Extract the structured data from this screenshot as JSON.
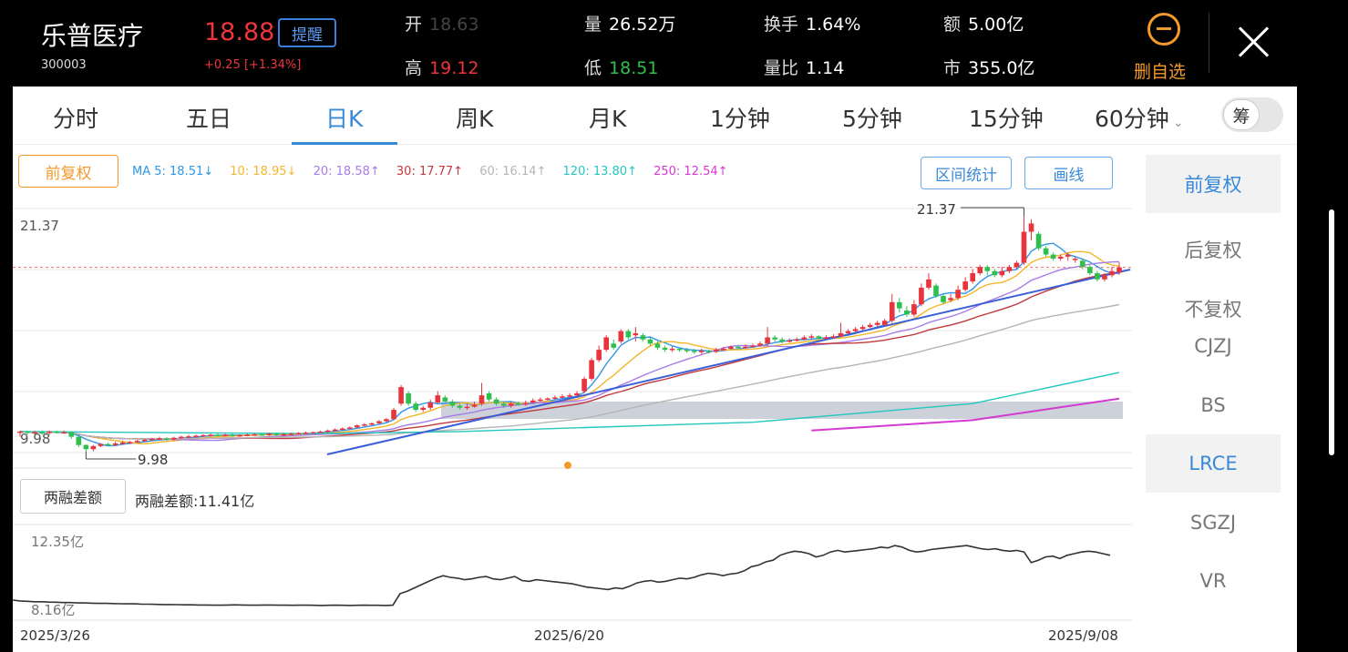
{
  "header": {
    "name": "乐普医疗",
    "code": "300003",
    "price": "18.88",
    "change": "+0.25 [+1.34%]",
    "alert_label": "提醒",
    "open_label": "开",
    "open_value": "18.63",
    "high_label": "高",
    "high_value": "19.12",
    "volume_label": "量",
    "volume_value": "26.52万",
    "low_label": "低",
    "low_value": "18.51",
    "turnover_label": "换手",
    "turnover_value": "1.64%",
    "volratio_label": "量比",
    "volratio_value": "1.14",
    "amount_label": "额",
    "amount_value": "5.00亿",
    "mktcap_label": "市",
    "mktcap_value": "355.0亿",
    "delete_label": "删自选"
  },
  "tabs": [
    "分时",
    "五日",
    "日K",
    "周K",
    "月K",
    "1分钟",
    "5分钟",
    "15分钟",
    "60分钟"
  ],
  "active_tab": "日K",
  "chip_toggle": "筹",
  "toolbar": {
    "adjust_label": "前复权",
    "ma": [
      {
        "text": "MA 5: 18.51↓",
        "color": "#2f97e6"
      },
      {
        "text": "10: 18.95↓",
        "color": "#f3b62a"
      },
      {
        "text": "20: 18.58↑",
        "color": "#a77be8"
      },
      {
        "text": "30: 17.77↑",
        "color": "#c0393b"
      },
      {
        "text": "60: 16.14↑",
        "color": "#b5b5b5"
      },
      {
        "text": "120: 13.80↑",
        "color": "#22c7c0"
      },
      {
        "text": "250: 12.54↑",
        "color": "#d43ad1"
      }
    ],
    "range_stats_label": "区间统计",
    "draw_label": "画线"
  },
  "price_axis": {
    "top": "21.37",
    "bottom": "9.98"
  },
  "markers": {
    "high": "21.37",
    "low": "9.98"
  },
  "margin": {
    "button_label": "两融差额",
    "value_text": "两融差额:11.41亿",
    "axis_top": "12.35亿",
    "axis_bottom": "8.16亿"
  },
  "dates": [
    "2025/3/26",
    "2025/6/20",
    "2025/9/08"
  ],
  "side_menu": [
    "前复权",
    "后复权",
    "不复权",
    "CJZJ",
    "BS",
    "LRCE",
    "SGZJ",
    "VR"
  ],
  "colors": {
    "up": "#e8343c",
    "down": "#2fbf4f",
    "accent": "#3a89d9",
    "orange": "#f39a2b"
  },
  "chart_data": {
    "type": "candlestick",
    "price_range": [
      9.98,
      21.37
    ],
    "candles": [
      [
        10.9,
        10.95,
        10.7,
        11.0
      ],
      [
        10.95,
        10.9,
        10.8,
        11.0
      ],
      [
        10.9,
        10.92,
        10.8,
        11.0
      ],
      [
        10.92,
        10.88,
        10.8,
        11.0
      ],
      [
        10.88,
        10.95,
        10.8,
        11.0
      ],
      [
        10.95,
        10.9,
        10.85,
        11.0
      ],
      [
        10.9,
        10.92,
        10.85,
        11.0
      ],
      [
        10.92,
        10.7,
        10.6,
        10.95
      ],
      [
        10.7,
        10.3,
        10.2,
        10.72
      ],
      [
        10.3,
        10.1,
        9.98,
        10.35
      ],
      [
        10.1,
        10.25,
        10.0,
        10.3
      ],
      [
        10.25,
        10.35,
        10.2,
        10.4
      ],
      [
        10.35,
        10.3,
        10.25,
        10.4
      ],
      [
        10.3,
        10.38,
        10.25,
        10.45
      ],
      [
        10.38,
        10.42,
        10.3,
        10.5
      ],
      [
        10.42,
        10.45,
        10.35,
        10.5
      ],
      [
        10.45,
        10.5,
        10.4,
        10.55
      ],
      [
        10.5,
        10.55,
        10.45,
        10.6
      ],
      [
        10.55,
        10.6,
        10.5,
        10.65
      ],
      [
        10.6,
        10.62,
        10.55,
        10.7
      ],
      [
        10.62,
        10.58,
        10.5,
        10.68
      ],
      [
        10.58,
        10.65,
        10.5,
        10.7
      ],
      [
        10.65,
        10.7,
        10.6,
        10.75
      ],
      [
        10.7,
        10.72,
        10.65,
        10.8
      ],
      [
        10.72,
        10.75,
        10.65,
        10.8
      ],
      [
        10.75,
        10.78,
        10.7,
        10.82
      ],
      [
        10.78,
        10.8,
        10.72,
        10.85
      ],
      [
        10.8,
        10.78,
        10.72,
        10.85
      ],
      [
        10.78,
        10.8,
        10.72,
        10.85
      ],
      [
        10.8,
        10.75,
        10.7,
        10.85
      ],
      [
        10.75,
        10.78,
        10.7,
        10.82
      ],
      [
        10.78,
        10.8,
        10.72,
        10.85
      ],
      [
        10.8,
        10.82,
        10.75,
        10.88
      ],
      [
        10.82,
        10.8,
        10.75,
        10.88
      ],
      [
        10.8,
        10.85,
        10.75,
        10.9
      ],
      [
        10.85,
        10.8,
        10.75,
        10.9
      ],
      [
        10.8,
        10.82,
        10.75,
        10.88
      ],
      [
        10.82,
        10.85,
        10.78,
        10.9
      ],
      [
        10.85,
        10.88,
        10.8,
        10.92
      ],
      [
        10.88,
        10.9,
        10.82,
        10.95
      ],
      [
        10.9,
        10.92,
        10.85,
        10.95
      ],
      [
        10.92,
        10.95,
        10.88,
        11.0
      ],
      [
        10.95,
        11.0,
        10.9,
        11.05
      ],
      [
        11.0,
        11.05,
        10.95,
        11.1
      ],
      [
        11.05,
        11.1,
        11.0,
        11.15
      ],
      [
        11.1,
        11.15,
        11.05,
        11.2
      ],
      [
        11.15,
        11.25,
        11.1,
        11.3
      ],
      [
        11.25,
        11.3,
        11.2,
        11.35
      ],
      [
        11.3,
        11.35,
        11.25,
        11.4
      ],
      [
        11.35,
        11.45,
        11.3,
        11.5
      ],
      [
        11.45,
        11.55,
        11.4,
        11.6
      ],
      [
        11.55,
        12.0,
        11.5,
        12.1
      ],
      [
        12.3,
        13.1,
        12.2,
        13.2
      ],
      [
        12.8,
        12.3,
        12.2,
        12.9
      ],
      [
        12.3,
        12.0,
        11.9,
        12.4
      ],
      [
        12.0,
        12.1,
        11.9,
        12.2
      ],
      [
        12.1,
        12.35,
        12.0,
        12.5
      ],
      [
        12.35,
        12.7,
        12.3,
        12.9
      ],
      [
        12.6,
        12.4,
        12.3,
        12.7
      ],
      [
        12.4,
        12.2,
        12.1,
        12.5
      ],
      [
        12.2,
        12.1,
        12.0,
        12.3
      ],
      [
        12.1,
        12.15,
        12.0,
        12.3
      ],
      [
        12.15,
        12.25,
        12.1,
        12.4
      ],
      [
        12.3,
        12.7,
        12.2,
        13.3
      ],
      [
        12.8,
        12.5,
        12.4,
        12.9
      ],
      [
        12.5,
        12.3,
        12.2,
        12.6
      ],
      [
        12.3,
        12.2,
        12.1,
        12.4
      ],
      [
        12.2,
        12.3,
        12.1,
        12.4
      ],
      [
        12.3,
        12.28,
        12.2,
        12.4
      ],
      [
        12.28,
        12.32,
        12.2,
        12.45
      ],
      [
        12.35,
        12.45,
        12.3,
        12.55
      ],
      [
        12.45,
        12.5,
        12.4,
        12.6
      ],
      [
        12.5,
        12.55,
        12.45,
        12.6
      ],
      [
        12.55,
        12.6,
        12.5,
        12.7
      ],
      [
        12.6,
        12.65,
        12.55,
        12.75
      ],
      [
        12.65,
        12.7,
        12.6,
        12.8
      ],
      [
        12.7,
        12.8,
        12.65,
        12.9
      ],
      [
        12.9,
        13.5,
        12.8,
        13.6
      ],
      [
        13.5,
        14.4,
        13.4,
        14.5
      ],
      [
        14.4,
        14.9,
        14.3,
        15.1
      ],
      [
        14.9,
        15.5,
        14.8,
        15.6
      ],
      [
        15.2,
        15.0,
        14.9,
        15.4
      ],
      [
        15.3,
        15.8,
        15.2,
        15.9
      ],
      [
        15.8,
        15.5,
        15.4,
        15.9
      ],
      [
        15.6,
        15.7,
        15.3,
        16.0
      ],
      [
        15.6,
        15.4,
        15.3,
        15.7
      ],
      [
        15.4,
        15.2,
        15.1,
        15.5
      ],
      [
        15.2,
        15.0,
        14.9,
        15.3
      ],
      [
        15.0,
        14.9,
        14.8,
        15.1
      ],
      [
        14.9,
        14.95,
        14.8,
        15.05
      ],
      [
        14.95,
        14.9,
        14.8,
        15.0
      ],
      [
        14.9,
        14.85,
        14.75,
        15.0
      ],
      [
        14.85,
        14.8,
        14.7,
        14.95
      ],
      [
        14.8,
        14.85,
        14.7,
        14.95
      ],
      [
        14.85,
        14.8,
        14.72,
        14.9
      ],
      [
        14.8,
        14.9,
        14.75,
        15.0
      ],
      [
        14.9,
        14.95,
        14.85,
        15.05
      ],
      [
        14.95,
        15.05,
        14.9,
        15.1
      ],
      [
        15.05,
        15.0,
        14.95,
        15.1
      ],
      [
        15.0,
        15.05,
        14.95,
        15.15
      ],
      [
        15.05,
        15.1,
        15.0,
        15.2
      ],
      [
        15.1,
        15.2,
        15.05,
        15.3
      ],
      [
        15.2,
        15.5,
        15.1,
        16.0
      ],
      [
        15.5,
        15.4,
        15.3,
        15.6
      ],
      [
        15.4,
        15.3,
        15.2,
        15.5
      ],
      [
        15.3,
        15.35,
        15.25,
        15.45
      ],
      [
        15.35,
        15.4,
        15.3,
        15.5
      ],
      [
        15.4,
        15.5,
        15.35,
        15.6
      ],
      [
        15.5,
        15.55,
        15.45,
        15.65
      ],
      [
        15.55,
        15.45,
        15.4,
        15.6
      ],
      [
        15.45,
        15.5,
        15.4,
        15.6
      ],
      [
        15.5,
        15.55,
        15.45,
        15.65
      ],
      [
        15.55,
        15.7,
        15.5,
        16.2
      ],
      [
        15.7,
        15.8,
        15.65,
        15.9
      ],
      [
        15.8,
        15.9,
        15.75,
        16.0
      ],
      [
        15.9,
        16.0,
        15.85,
        16.1
      ],
      [
        16.0,
        16.1,
        15.95,
        16.2
      ],
      [
        16.1,
        16.2,
        16.0,
        16.3
      ],
      [
        16.1,
        16.3,
        16.05,
        16.4
      ],
      [
        16.3,
        17.2,
        16.2,
        17.6
      ],
      [
        17.2,
        16.9,
        16.7,
        17.4
      ],
      [
        16.8,
        16.6,
        16.5,
        17.0
      ],
      [
        16.6,
        17.1,
        16.5,
        17.3
      ],
      [
        17.1,
        17.9,
        17.0,
        18.1
      ],
      [
        17.9,
        18.3,
        17.8,
        18.6
      ],
      [
        18.0,
        17.5,
        17.4,
        18.1
      ],
      [
        17.5,
        17.2,
        17.1,
        17.6
      ],
      [
        17.3,
        17.4,
        17.2,
        17.6
      ],
      [
        17.4,
        17.8,
        17.3,
        18.0
      ],
      [
        17.8,
        18.2,
        17.7,
        18.4
      ],
      [
        18.2,
        18.6,
        18.1,
        18.8
      ],
      [
        18.6,
        18.9,
        18.5,
        19.0
      ],
      [
        18.9,
        18.7,
        18.5,
        19.0
      ],
      [
        18.7,
        18.5,
        18.4,
        18.8
      ],
      [
        18.5,
        18.7,
        18.4,
        18.9
      ],
      [
        18.7,
        18.9,
        18.6,
        19.0
      ],
      [
        18.9,
        19.1,
        18.8,
        19.2
      ],
      [
        19.1,
        20.6,
        19.0,
        21.37
      ],
      [
        20.6,
        21.0,
        20.2,
        21.2
      ],
      [
        20.5,
        19.8,
        19.7,
        20.6
      ],
      [
        19.8,
        19.5,
        19.4,
        19.9
      ],
      [
        19.5,
        19.3,
        19.2,
        19.6
      ],
      [
        19.3,
        19.4,
        19.2,
        19.5
      ],
      [
        19.4,
        19.5,
        19.2,
        19.6
      ],
      [
        19.3,
        19.3,
        19.1,
        19.4
      ],
      [
        19.2,
        18.9,
        18.8,
        19.3
      ],
      [
        18.9,
        18.6,
        18.5,
        19.0
      ],
      [
        18.6,
        18.3,
        18.2,
        18.7
      ],
      [
        18.3,
        18.5,
        18.2,
        18.6
      ],
      [
        18.5,
        18.7,
        18.4,
        18.9
      ],
      [
        18.63,
        18.88,
        18.51,
        19.12
      ]
    ],
    "ma_labels": [
      "MA5",
      "MA10",
      "MA20",
      "MA30",
      "MA60",
      "MA120",
      "MA250"
    ],
    "ma_last_values": [
      18.51,
      18.95,
      18.58,
      17.77,
      16.14,
      13.8,
      12.54
    ],
    "margin_series_range": [
      8.16,
      12.35
    ],
    "margin_last": 11.41,
    "margin_series": [
      8.55,
      8.5,
      8.48,
      8.45,
      8.45,
      8.43,
      8.42,
      8.4,
      8.4,
      8.38,
      8.38,
      8.36,
      8.35,
      8.35,
      8.34,
      8.33,
      8.32,
      8.32,
      8.3,
      8.3,
      8.29,
      8.28,
      8.28,
      8.27,
      8.26,
      8.26,
      8.25,
      8.25,
      8.24,
      8.24,
      8.25,
      8.26,
      8.25,
      8.24,
      8.24,
      8.25,
      8.25,
      8.24,
      8.24,
      8.23,
      8.24,
      8.24,
      8.23,
      8.22,
      8.23,
      8.24,
      8.23,
      8.22,
      8.23,
      8.24,
      8.23,
      8.23,
      8.22,
      8.24,
      8.95,
      9.1,
      9.3,
      9.5,
      9.7,
      9.9,
      10.05,
      9.95,
      9.9,
      9.8,
      9.85,
      9.95,
      10.0,
      9.85,
      9.8,
      9.9,
      10.0,
      9.75,
      9.7,
      9.8,
      9.75,
      9.7,
      9.65,
      9.6,
      9.55,
      9.45,
      9.35,
      9.3,
      9.25,
      9.2,
      9.3,
      9.25,
      9.4,
      9.6,
      9.7,
      9.75,
      9.65,
      9.7,
      9.8,
      9.9,
      9.85,
      9.95,
      10.1,
      10.2,
      10.15,
      10.05,
      10.15,
      10.2,
      10.35,
      10.6,
      10.7,
      10.9,
      11.0,
      11.3,
      11.45,
      11.55,
      11.5,
      11.4,
      11.2,
      11.3,
      11.5,
      11.6,
      11.5,
      11.55,
      11.6,
      11.65,
      11.7,
      11.8,
      11.75,
      11.9,
      11.8,
      11.6,
      11.5,
      11.55,
      11.65,
      11.7,
      11.75,
      11.8,
      11.85,
      11.9,
      11.8,
      11.7,
      11.65,
      11.7,
      11.6,
      11.55,
      11.6,
      11.5,
      10.85,
      11.0,
      11.2,
      11.25,
      11.1,
      11.3,
      11.4,
      11.5,
      11.55,
      11.5,
      11.4,
      11.3
    ]
  }
}
